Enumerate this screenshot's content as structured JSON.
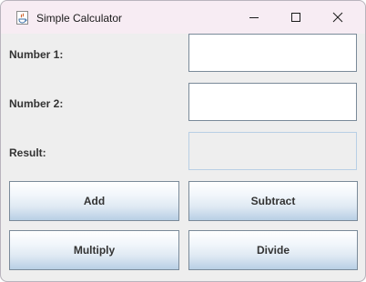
{
  "window": {
    "title": "Simple Calculator",
    "controls": [
      "minimize-icon",
      "maximize-icon",
      "close-icon"
    ]
  },
  "form": {
    "number1_label": "Number 1:",
    "number1_value": "",
    "number2_label": "Number 2:",
    "number2_value": "",
    "result_label": "Result:",
    "result_value": ""
  },
  "buttons": {
    "add": "Add",
    "subtract": "Subtract",
    "multiply": "Multiply",
    "divide": "Divide"
  },
  "colors": {
    "titlebar": "#f7ecf3",
    "panel": "#eeeeee",
    "button_gradient_bottom": "#b8cfe5",
    "border": "#7a8a99"
  }
}
